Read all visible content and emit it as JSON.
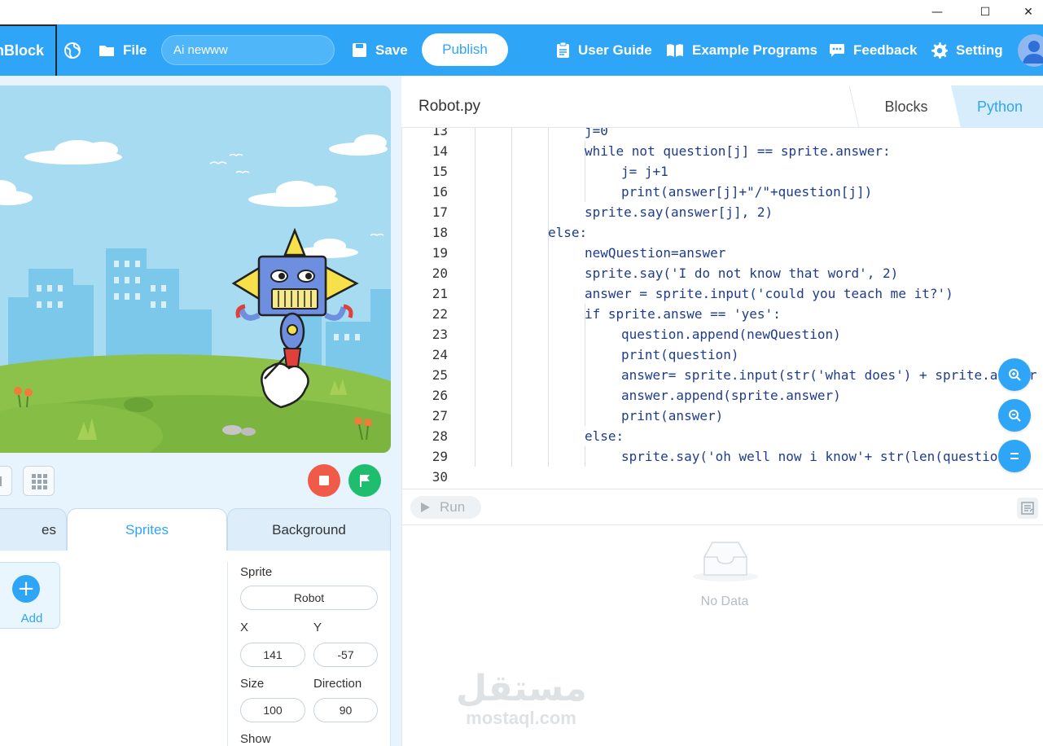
{
  "window": {
    "minimize": "—",
    "maximize": "☐",
    "close": "✕"
  },
  "toolbar": {
    "brand": "mBlock",
    "file": "File",
    "project_name": "Ai newww",
    "save": "Save",
    "publish": "Publish",
    "user_guide": "User Guide",
    "example_programs": "Example Programs",
    "feedback": "Feedback",
    "setting": "Setting"
  },
  "editor": {
    "file_name": "Robot.py",
    "mode_blocks": "Blocks",
    "mode_python": "Python",
    "lines": [
      {
        "n": "13",
        "text": "j=0",
        "indent": 3
      },
      {
        "n": "14",
        "text": "while not question[j] == sprite.answer:",
        "indent": 3
      },
      {
        "n": "15",
        "text": "j= j+1",
        "indent": 4
      },
      {
        "n": "16",
        "text": "print(answer[j]+\"/\"+question[j])",
        "indent": 4
      },
      {
        "n": "17",
        "text": "sprite.say(answer[j], 2)",
        "indent": 3
      },
      {
        "n": "18",
        "text": "else:",
        "indent": 2
      },
      {
        "n": "19",
        "text": "newQuestion=answer",
        "indent": 3
      },
      {
        "n": "20",
        "text": "sprite.say('I do not know that word', 2)",
        "indent": 3
      },
      {
        "n": "21",
        "text": "answer = sprite.input('could you teach me it?')",
        "indent": 3
      },
      {
        "n": "22",
        "text": "if sprite.answe == 'yes':",
        "indent": 3
      },
      {
        "n": "23",
        "text": "question.append(newQuestion)",
        "indent": 4
      },
      {
        "n": "24",
        "text": "print(question)",
        "indent": 4
      },
      {
        "n": "25",
        "text": "answer= sprite.input(str('what does') + sprite.answer",
        "indent": 4
      },
      {
        "n": "26",
        "text": "answer.append(sprite.answer)",
        "indent": 4
      },
      {
        "n": "27",
        "text": "print(answer)",
        "indent": 4
      },
      {
        "n": "28",
        "text": "else:",
        "indent": 3
      },
      {
        "n": "29",
        "text": "sprite.say('oh well now i know'+ str(len(question",
        "indent": 4
      },
      {
        "n": "30",
        "text": "",
        "indent": 0
      }
    ]
  },
  "console": {
    "run": "Run",
    "empty": "No Data"
  },
  "stage_tabs": {
    "costumes": "es",
    "sprites": "Sprites",
    "background": "Background"
  },
  "sprites_panel": {
    "add": "Add",
    "sprite_label": "Sprite",
    "sprite_name": "Robot",
    "x_label": "X",
    "x_value": "141",
    "y_label": "Y",
    "y_value": "-57",
    "size_label": "Size",
    "size_value": "100",
    "direction_label": "Direction",
    "direction_value": "90",
    "show_label": "Show"
  },
  "watermark": {
    "arabic": "مستقل",
    "latin": "mostaql.com"
  },
  "colors": {
    "accent": "#2ea5f7",
    "stop": "#f05a48",
    "go": "#1fbe6e"
  }
}
